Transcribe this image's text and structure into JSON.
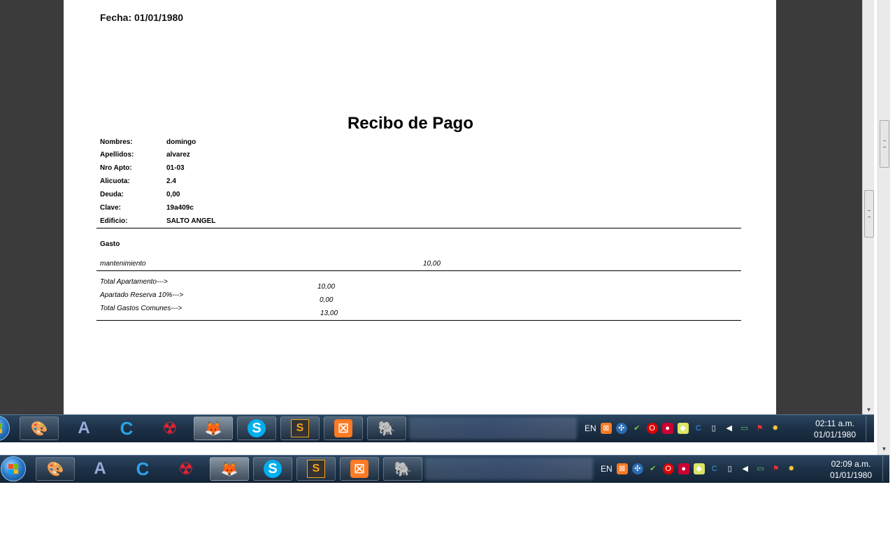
{
  "receipt": {
    "fecha_label": "Fecha: 01/01/1980",
    "title": "Recibo de Pago",
    "fields": [
      {
        "label": "Nombres:",
        "value": "domingo"
      },
      {
        "label": "Apellidos:",
        "value": "alvarez"
      },
      {
        "label": "Nro Apto:",
        "value": "01-03"
      },
      {
        "label": "Alicuota:",
        "value": "2.4"
      },
      {
        "label": "Deuda:",
        "value": "0,00"
      },
      {
        "label": "Clave:",
        "value": "19a409c"
      },
      {
        "label": "Edificio:",
        "value": "SALTO ANGEL"
      }
    ],
    "gasto_header": "Gasto",
    "expenses": [
      {
        "name": "mantenimiento",
        "amount": "10,00"
      }
    ],
    "totals": [
      {
        "label": "Total Apartamento--->",
        "value": "10,00"
      },
      {
        "label": "Apartado Reserva 10%--->",
        "value": "0,00"
      },
      {
        "label": "Total Gastos Comunes--->",
        "value": "13,00"
      }
    ]
  },
  "taskbar_inner": {
    "language": "EN",
    "time": "02:11 a.m.",
    "date": "01/01/1980"
  },
  "taskbar_outer": {
    "language": "EN",
    "time": "02:09 a.m.",
    "date": "01/01/1980"
  },
  "taskbar_apps": [
    {
      "name": "paint-icon",
      "glyph": "🎨"
    },
    {
      "name": "argouml-icon",
      "glyph": "A"
    },
    {
      "name": "ccleaner-icon",
      "glyph": "C"
    },
    {
      "name": "antivirus-icon",
      "glyph": "☢"
    },
    {
      "name": "firefox-icon",
      "glyph": "🦊"
    },
    {
      "name": "skype-icon",
      "glyph": "S"
    },
    {
      "name": "sublime-text-icon",
      "glyph": "S"
    },
    {
      "name": "xampp-icon",
      "glyph": "⊠"
    },
    {
      "name": "postgresql-icon",
      "glyph": "🐘"
    }
  ],
  "colors": {
    "taskbar": "#1d3248",
    "xampp": "#fb7a24",
    "skype": "#00aff0",
    "firefox": "#ff7139"
  }
}
